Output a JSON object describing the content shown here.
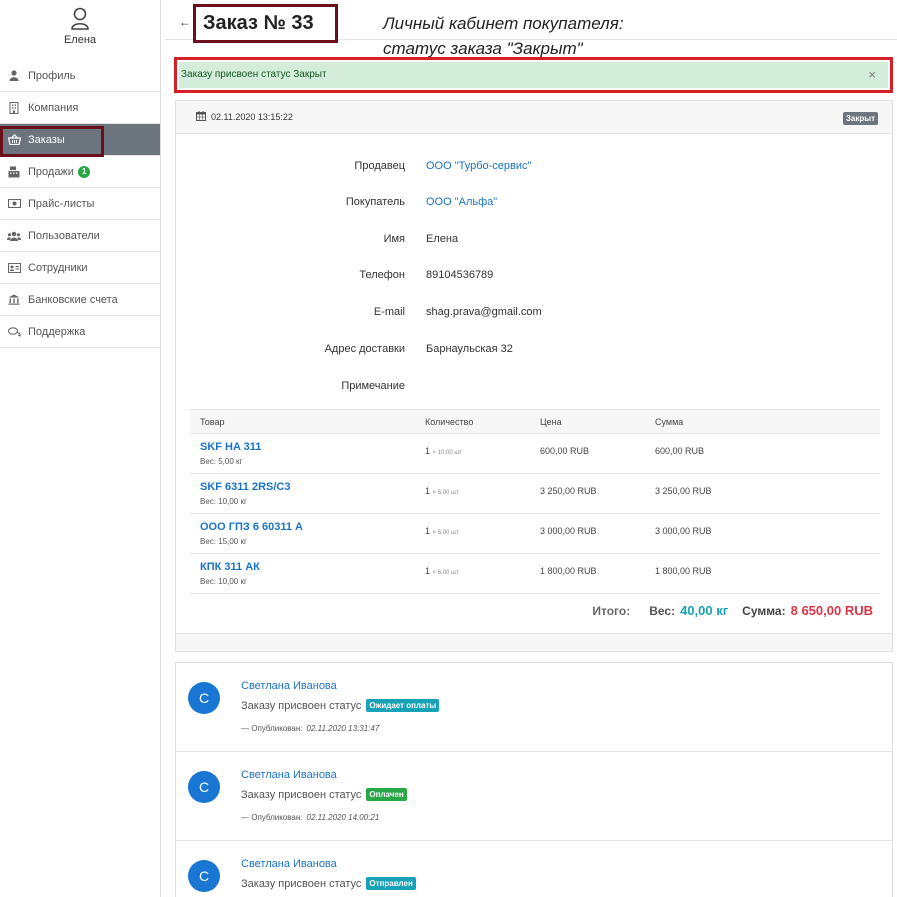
{
  "sidebar": {
    "user_name": "Елена",
    "items": [
      {
        "label": "Профиль",
        "icon": "user-icon"
      },
      {
        "label": "Компания",
        "icon": "building-icon"
      },
      {
        "label": "Заказы",
        "icon": "basket-icon",
        "active": true
      },
      {
        "label": "Продажи",
        "icon": "cash-register-icon",
        "badge": "1"
      },
      {
        "label": "Прайс-листы",
        "icon": "money-bill-icon"
      },
      {
        "label": "Пользователи",
        "icon": "users-icon"
      },
      {
        "label": "Сотрудники",
        "icon": "id-card-icon"
      },
      {
        "label": "Банковские счета",
        "icon": "bank-icon"
      },
      {
        "label": "Поддержка",
        "icon": "chat-icon"
      }
    ]
  },
  "header": {
    "back": "←",
    "title": "Заказ № 33",
    "caption_line1": "Личный кабинет покупателя:",
    "caption_line2": "статус заказа \"Закрыт\""
  },
  "alert": {
    "text": "Заказу присвоен статус Закрыт",
    "close": "×"
  },
  "order": {
    "date": "02.11.2020 13:15:22",
    "status": "Закрыт",
    "fields": [
      {
        "label": "Продавец",
        "value": "ООО \"Турбо-сервис\"",
        "link": true
      },
      {
        "label": "Покупатель",
        "value": "ООО \"Альфа\"",
        "link": true
      },
      {
        "label": "Имя",
        "value": "Елена",
        "link": false
      },
      {
        "label": "Телефон",
        "value": "89104536789",
        "link": false
      },
      {
        "label": "E-mail",
        "value": "shag.prava@gmail.com",
        "link": false
      },
      {
        "label": "Адрес доставки",
        "value": "Барнаульская 32",
        "link": false
      },
      {
        "label": "Примечание",
        "value": "",
        "link": false
      }
    ],
    "columns": [
      "Товар",
      "Количество",
      "Цена",
      "Сумма"
    ],
    "items": [
      {
        "name": "SKF HA 311",
        "weight": "Вес: 5,00 кг",
        "qty": "1",
        "qty_note": "× 10.00 шт",
        "price": "600,00 RUB",
        "sum": "600,00 RUB"
      },
      {
        "name": "SKF 6311 2RS/C3",
        "weight": "Вес: 10,00 кг",
        "qty": "1",
        "qty_note": "× 5.00 шт",
        "price": "3 250,00 RUB",
        "sum": "3 250,00 RUB"
      },
      {
        "name": "ООО ГПЗ 6 60311 А",
        "weight": "Вес: 15,00 кг",
        "qty": "1",
        "qty_note": "× 5.00 шт",
        "price": "3 000,00 RUB",
        "sum": "3 000,00 RUB"
      },
      {
        "name": "КПК 311 АК",
        "weight": "Вес: 10,00 кг",
        "qty": "1",
        "qty_note": "× 6.00 шт",
        "price": "1 800,00 RUB",
        "sum": "1 800,00 RUB"
      }
    ],
    "totals": {
      "label": "Итого:",
      "weight_label": "Вес:",
      "weight": "40,00 кг",
      "sum_label": "Сумма:",
      "sum": "8 650,00 RUB"
    }
  },
  "history": [
    {
      "initial": "С",
      "author": "Светлана Иванова",
      "text": "Заказу присвоен статус",
      "status": "Ожидает оплаты",
      "status_color": "#17a2b8",
      "meta_label": "— Опубликован:",
      "date": "02.11.2020 13:31:47"
    },
    {
      "initial": "С",
      "author": "Светлана Иванова",
      "text": "Заказу присвоен статус",
      "status": "Оплачен",
      "status_color": "#28a745",
      "meta_label": "— Опубликован:",
      "date": "02.11.2020 14:00:21"
    },
    {
      "initial": "С",
      "author": "Светлана Иванова",
      "text": "Заказу присвоен статус",
      "status": "Отправлен",
      "status_color": "#17a2b8",
      "meta_label": "",
      "date": ""
    }
  ]
}
